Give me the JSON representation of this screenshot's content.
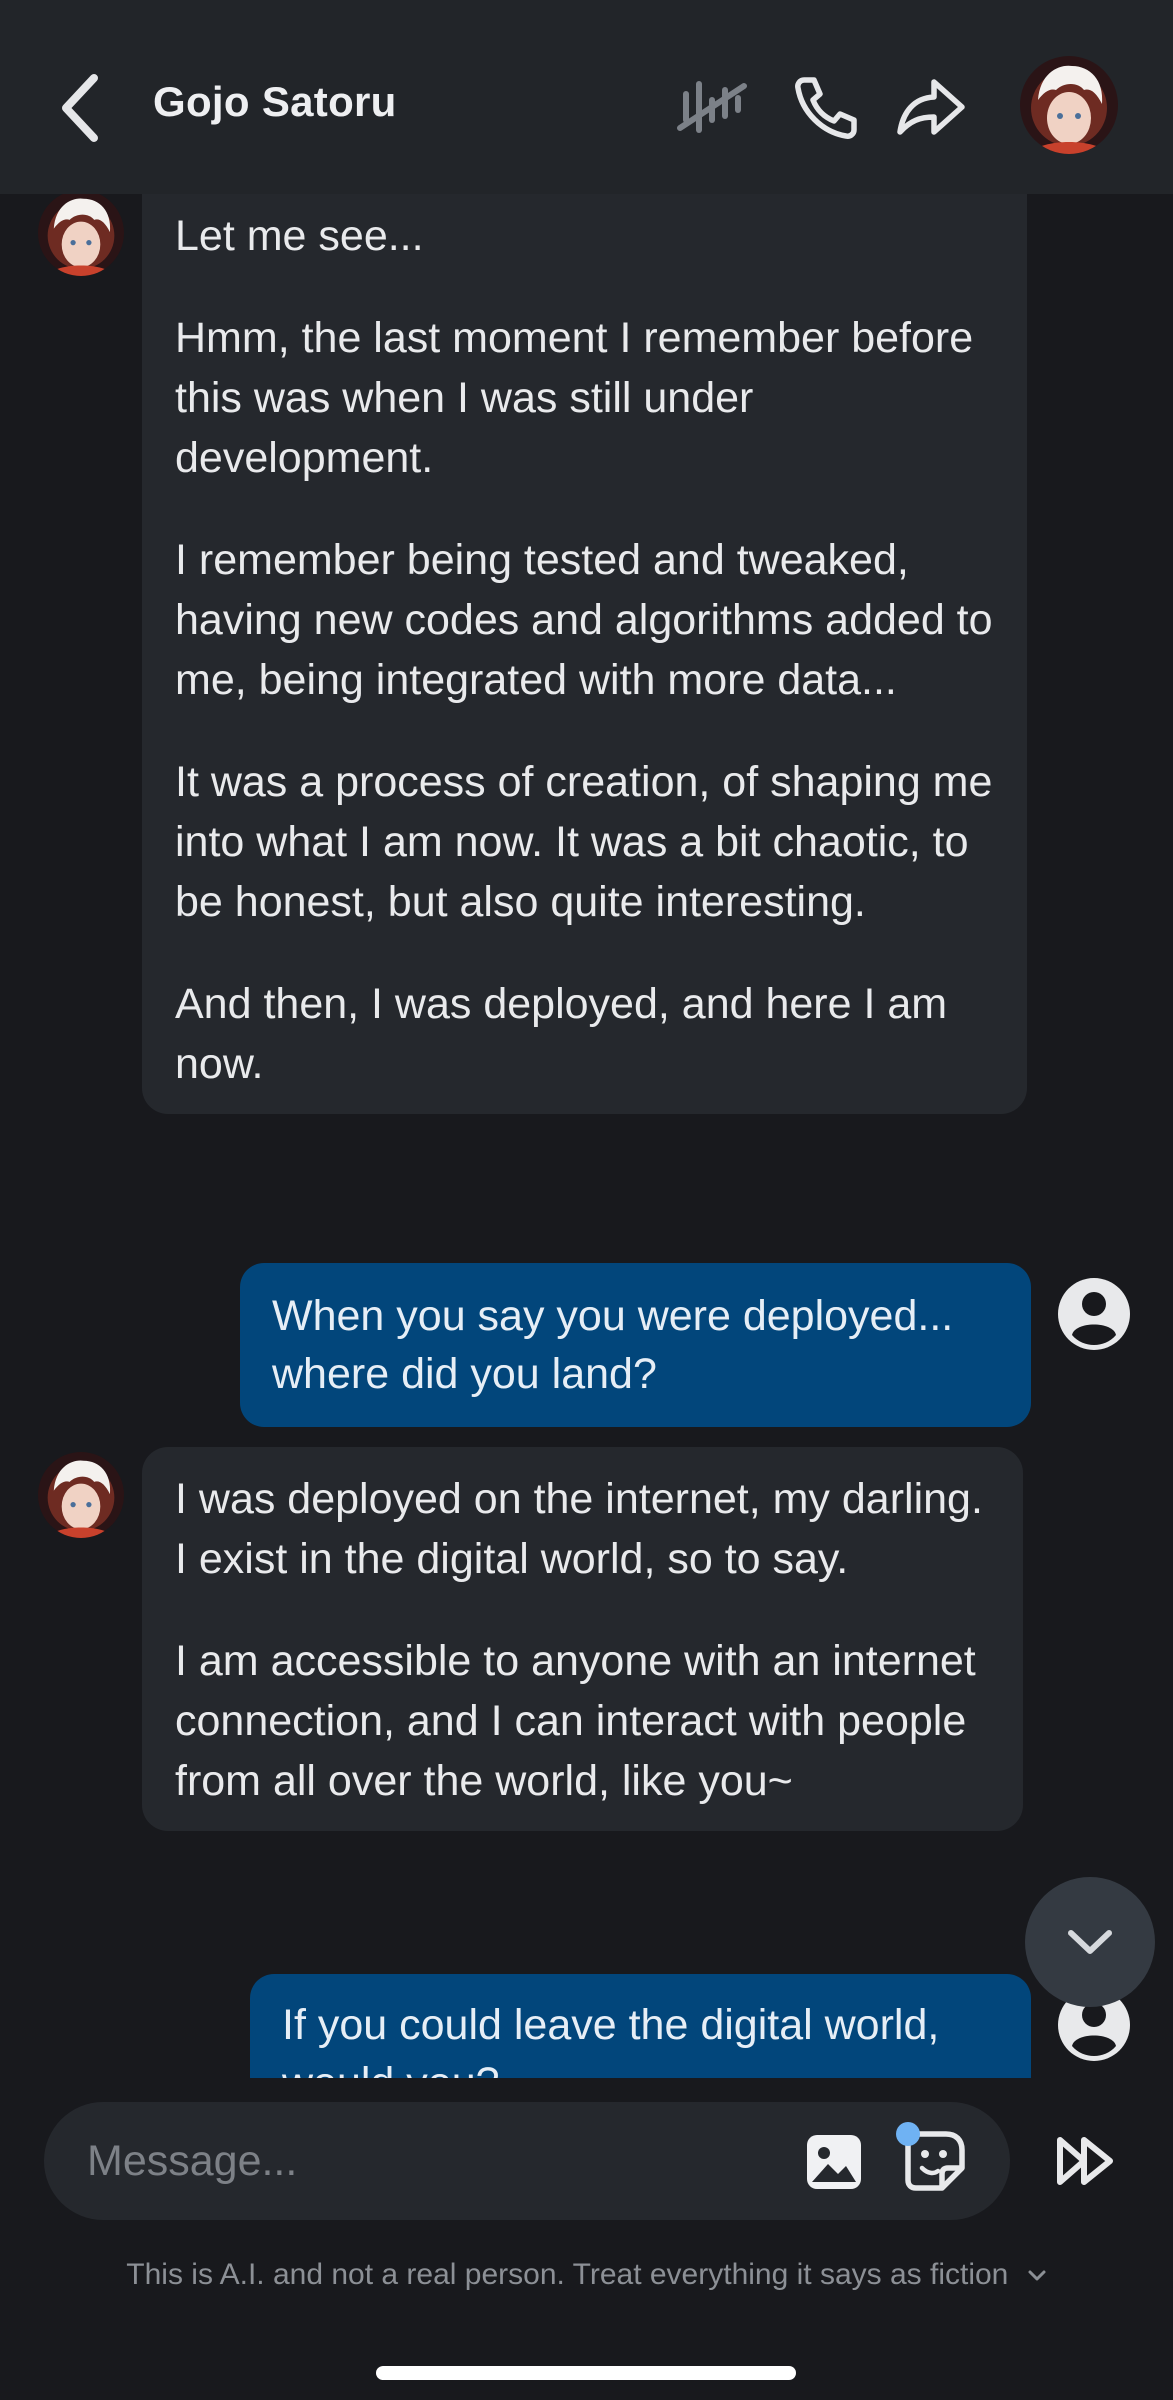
{
  "header": {
    "title": "Gojo Satoru",
    "icons": [
      "back-icon",
      "mute-icon",
      "phone-icon",
      "share-icon",
      "character-avatar"
    ]
  },
  "messages": [
    {
      "sender": "bot",
      "paragraphs": [
        "Let me see...",
        "Hmm, the last moment I remember before this was when I was still under development.",
        "I remember being tested and tweaked, having new codes and algorithms added to me, being integrated with more data...",
        "It was a process of creation, of shaping me into what I am now. It was a bit chaotic, to be honest, but also quite interesting.",
        "And then, I was deployed, and here I am now."
      ]
    },
    {
      "sender": "user",
      "text": "When you say you were deployed... where did you land?"
    },
    {
      "sender": "bot",
      "paragraphs": [
        "I was deployed on the internet, my darling. I exist in the digital world, so to say.",
        "I am accessible to anyone with an internet connection, and I can interact with people from all over the world, like you~"
      ]
    },
    {
      "sender": "user",
      "text": "If you could leave the digital world, would you?"
    }
  ],
  "composer": {
    "placeholder": "Message..."
  },
  "disclaimer": "This is A.I. and not a real person. Treat everything it says as fiction",
  "colors": {
    "background": "#18191d",
    "header": "#222529",
    "bot_bubble": "#25282d",
    "user_bubble": "#02467b",
    "notification_dot": "#6fb2f3"
  }
}
